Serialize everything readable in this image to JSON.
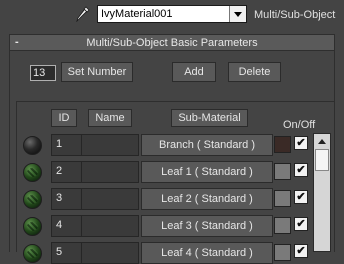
{
  "toolbar": {
    "eyedropper_icon": "eyedropper-icon",
    "material_name": "IvyMaterial001",
    "material_type": "Multi/Sub-Object"
  },
  "rollout": {
    "collapse_symbol": "-",
    "title": "Multi/Sub-Object Basic Parameters"
  },
  "controls": {
    "count": "13",
    "set_number": "Set Number",
    "add": "Add",
    "delete": "Delete"
  },
  "columns": {
    "id": "ID",
    "name": "Name",
    "sub_material": "Sub-Material",
    "on_off": "On/Off"
  },
  "rows": [
    {
      "id": "1",
      "name": "",
      "material": "Branch  ( Standard )",
      "swatch": "#3a2a26",
      "checked": "✔",
      "sphere": "dark"
    },
    {
      "id": "2",
      "name": "",
      "material": "Leaf 1  ( Standard )",
      "swatch": "#7a7a7a",
      "checked": "✔",
      "sphere": "green"
    },
    {
      "id": "3",
      "name": "",
      "material": "Leaf 2  ( Standard )",
      "swatch": "#7a7a7a",
      "checked": "✔",
      "sphere": "green"
    },
    {
      "id": "4",
      "name": "",
      "material": "Leaf 3  ( Standard )",
      "swatch": "#7a7a7a",
      "checked": "✔",
      "sphere": "green"
    },
    {
      "id": "5",
      "name": "",
      "material": "Leaf 4  ( Standard )",
      "swatch": "#7a7a7a",
      "checked": "✔",
      "sphere": "green"
    }
  ],
  "colors": {
    "background": "#444444",
    "rollout_header": "#5a5a5a",
    "button": "#595959",
    "field": "#3a3a3a",
    "scrollbar": "#c8c8c8"
  }
}
